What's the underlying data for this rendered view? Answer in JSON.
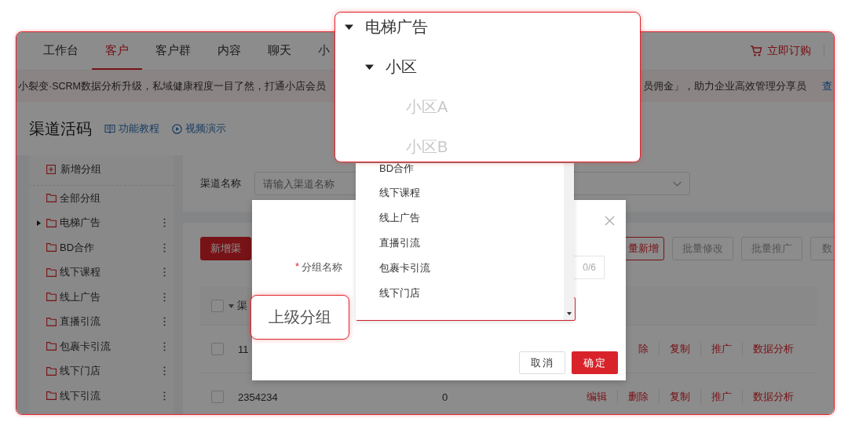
{
  "nav": {
    "tabs": [
      {
        "label": "工作台",
        "selected": false
      },
      {
        "label": "客户",
        "selected": true
      },
      {
        "label": "客户群",
        "selected": false
      },
      {
        "label": "内容",
        "selected": false
      },
      {
        "label": "聊天",
        "selected": false
      },
      {
        "label": "小",
        "selected": false
      }
    ],
    "order": "立即订购"
  },
  "banner": {
    "text_start": "小裂变·SCRM数据分析升级，私域健康程度一目了然，打通小店会员",
    "text_end": "员佣金」，助力企业高效管理分享员",
    "link": "查"
  },
  "header": {
    "title": "渠道活码",
    "links": [
      {
        "label": "功能教程",
        "kind": "book"
      },
      {
        "label": "视频演示",
        "kind": "play"
      }
    ]
  },
  "sidebar": {
    "add": "新增分组",
    "items": [
      {
        "label": "全部分组",
        "has_children": false,
        "menu": false
      },
      {
        "label": "电梯广告",
        "has_children": true,
        "menu": true
      },
      {
        "label": "BD合作",
        "has_children": false,
        "menu": true
      },
      {
        "label": "线下课程",
        "has_children": false,
        "menu": true
      },
      {
        "label": "线上广告",
        "has_children": false,
        "menu": true
      },
      {
        "label": "直播引流",
        "has_children": false,
        "menu": true
      },
      {
        "label": "包裹卡引流",
        "has_children": false,
        "menu": true
      },
      {
        "label": "线下门店",
        "has_children": false,
        "menu": true
      },
      {
        "label": "线下引流",
        "has_children": false,
        "menu": true
      }
    ]
  },
  "filter": {
    "label": "渠道名称",
    "placeholder": "请输入渠道名称"
  },
  "actions": [
    {
      "label": "新增渠",
      "kind": "primary"
    },
    {
      "label": "量新增",
      "kind": "outline"
    },
    {
      "label": "批量修改",
      "kind": "plain"
    },
    {
      "label": "批量推广",
      "kind": "plain"
    },
    {
      "label": "数",
      "kind": "plain"
    }
  ],
  "table": {
    "header": {
      "label": "渠",
      "checked": false
    },
    "rows": [
      {
        "name": "11",
        "checked": false,
        "actions": [
          "除",
          "复制",
          "推广",
          "数据分析"
        ]
      },
      {
        "name": "2354234",
        "count": "0",
        "checked": false,
        "actions": [
          "编辑",
          "删除",
          "复制",
          "推广",
          "数据分析"
        ]
      }
    ]
  },
  "modal": {
    "name_field": {
      "label": "分组名称",
      "required_mark": "*",
      "counter": "0/6"
    },
    "buttons": [
      {
        "label": "取消",
        "kind": "default"
      },
      {
        "label": "确定",
        "kind": "primary"
      }
    ]
  },
  "dropdown": {
    "options": [
      "BD合作",
      "线下课程",
      "线上广告",
      "直播引流",
      "包裹卡引流",
      "线下门店"
    ]
  },
  "callouts": {
    "tree": [
      {
        "label": "电梯广告",
        "expanded": true,
        "disabled": false,
        "children": [
          {
            "label": "小区",
            "expanded": true,
            "disabled": false,
            "children": [
              {
                "label": "小区A",
                "disabled": true
              },
              {
                "label": "小区B",
                "disabled": true
              }
            ]
          }
        ]
      }
    ],
    "field_label": "上级分组"
  }
}
